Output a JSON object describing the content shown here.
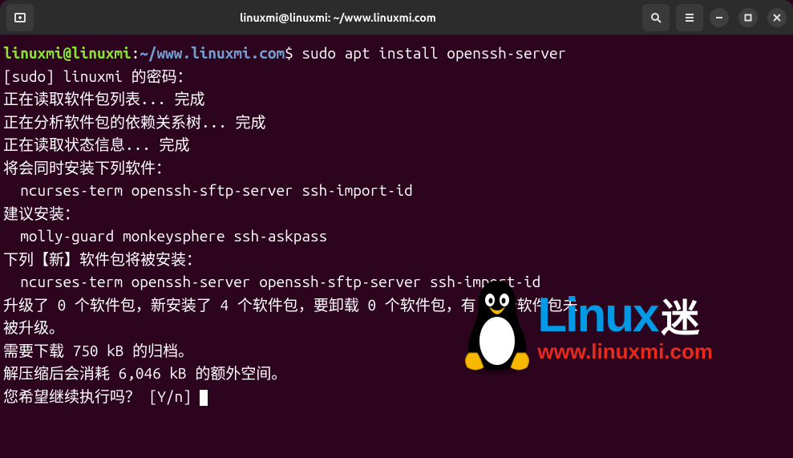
{
  "titlebar": {
    "title": "linuxmi@linuxmi: ~/www.linuxmi.com"
  },
  "prompt": {
    "user_host": "linuxmi@linuxmi",
    "colon": ":",
    "path": "~/www.linuxmi.com",
    "dollar": "$",
    "command": "sudo apt install openssh-server"
  },
  "output": {
    "line1": "[sudo] linuxmi 的密码：",
    "line2": "正在读取软件包列表... 完成",
    "line3": "正在分析软件包的依赖关系树... 完成",
    "line4": "正在读取状态信息... 完成",
    "line5": "将会同时安装下列软件：",
    "line6": "  ncurses-term openssh-sftp-server ssh-import-id",
    "line7": "建议安装：",
    "line8": "  molly-guard monkeysphere ssh-askpass",
    "line9": "下列【新】软件包将被安装：",
    "line10": "  ncurses-term openssh-server openssh-sftp-server ssh-import-id",
    "line11": "升级了 0 个软件包，新安装了 4 个软件包，要卸载 0 个软件包，有 0 个软件包未",
    "line12": "被升级。",
    "line13": "需要下载 750 kB 的归档。",
    "line14": "解压缩后会消耗 6,046 kB 的额外空间。",
    "line15": "您希望继续执行吗？ [Y/n] "
  },
  "watermark": {
    "brand": "Linux",
    "suffix": "迷",
    "url": "www.linuxmi.com"
  }
}
